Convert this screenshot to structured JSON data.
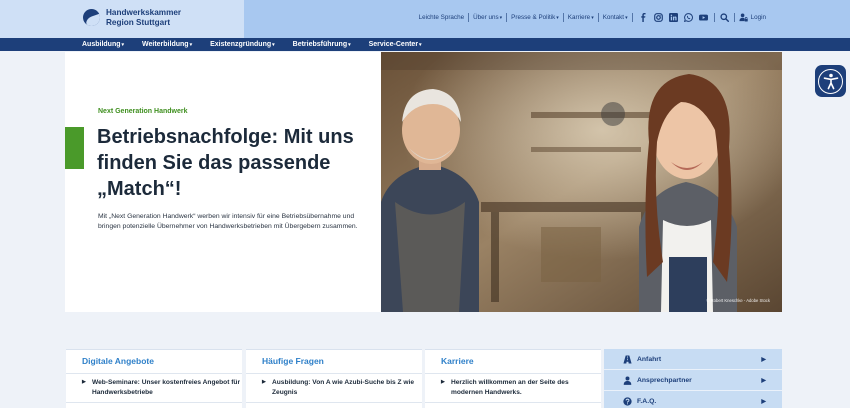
{
  "header": {
    "logo_line1": "Handwerkskammer",
    "logo_line2": "Region Stuttgart",
    "utility_links": {
      "easy_language": "Leichte Sprache",
      "about": "Über uns",
      "press": "Presse & Politik",
      "career": "Karriere",
      "contact": "Kontakt"
    },
    "social_icons": [
      "facebook-icon",
      "instagram-icon",
      "linkedin-icon",
      "whatsapp-icon",
      "youtube-icon"
    ],
    "login_label": "Login"
  },
  "nav": {
    "items": [
      "Ausbildung",
      "Weiterbildung",
      "Existenzgründung",
      "Betriebsführung",
      "Service-Center"
    ]
  },
  "hero": {
    "kicker": "Next Generation Handwerk",
    "headline": "Betriebsnachfolge: Mit uns finden Sie das passende „Match“!",
    "teaser": "Mit „Next Generation Handwerk“ werben wir intensiv für eine Betriebsübernahme und bringen potenzielle Übernehmer von Handwerksbetrieben mit Übergebern zusammen.",
    "photo_credit": "© Robert Kneschke - Adobe Stock"
  },
  "cards": [
    {
      "title": "Digitale Angebote",
      "first_item": "Web-Seminare: Unser kostenfreies Angebot für Handwerksbetriebe"
    },
    {
      "title": "Häufige Fragen",
      "first_item": "Ausbildung: Von A wie Azubi-Suche bis Z wie Zeugnis"
    },
    {
      "title": "Karriere",
      "first_item": "Herzlich willkommen an der Seite des modernen Handwerks."
    }
  ],
  "quick_links": [
    {
      "label": "Anfahrt",
      "icon": "directions-icon"
    },
    {
      "label": "Ansprechpartner",
      "icon": "person-icon"
    },
    {
      "label": "F.A.Q.",
      "icon": "question-icon"
    }
  ],
  "colors": {
    "brand_navy": "#1d3f7a",
    "header_blue": "#a8c8f0",
    "accent_green": "#4a9a2a",
    "link_blue": "#2f80c9"
  }
}
